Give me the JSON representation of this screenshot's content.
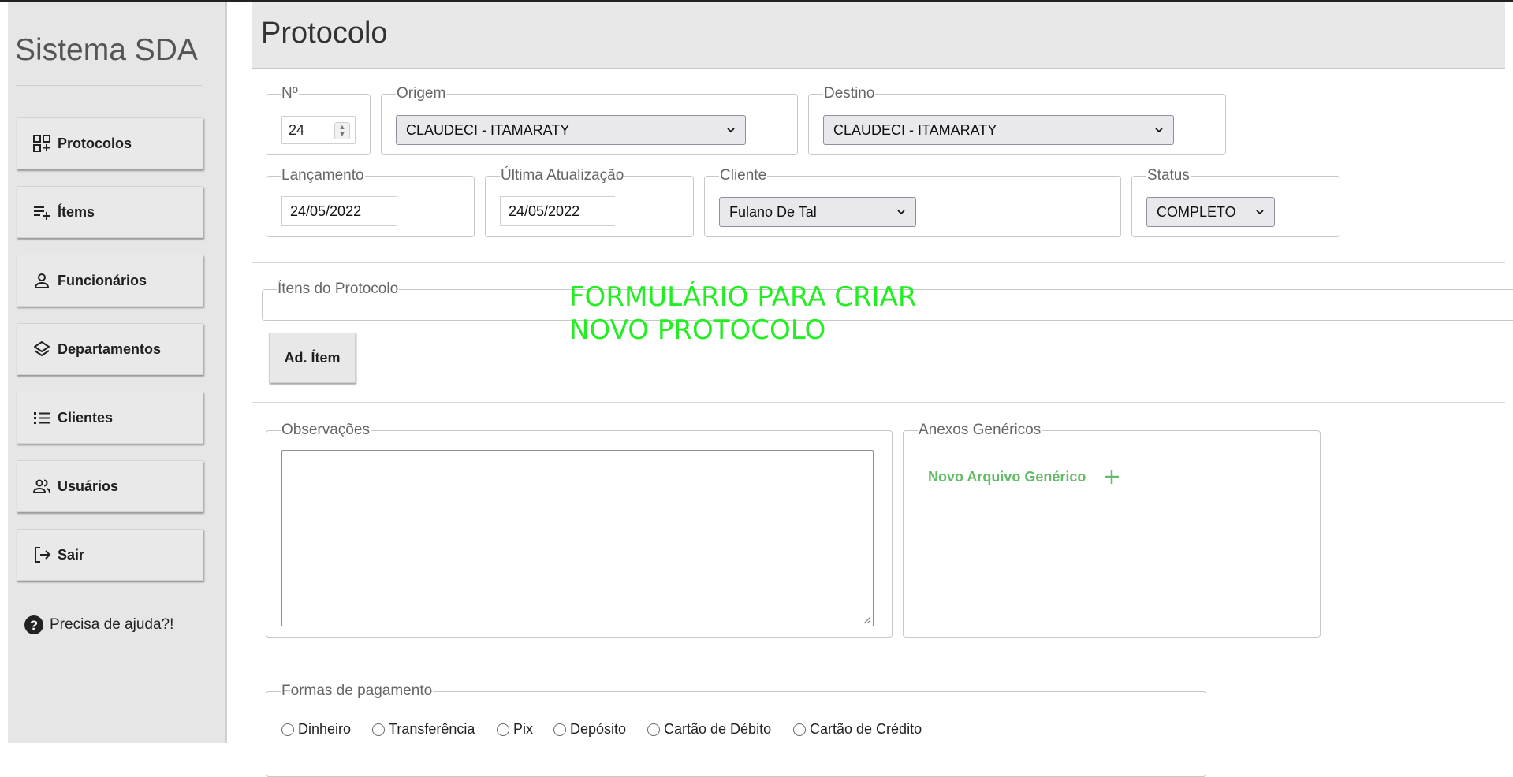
{
  "app": {
    "title": "Sistema SDA"
  },
  "sidebar": {
    "items": [
      {
        "label": "Protocolos",
        "icon": "add-grid-icon"
      },
      {
        "label": "Ítems",
        "icon": "playlist-add-icon"
      },
      {
        "label": "Funcionários",
        "icon": "person-icon"
      },
      {
        "label": "Departamentos",
        "icon": "layers-icon"
      },
      {
        "label": "Clientes",
        "icon": "list-icon"
      },
      {
        "label": "Usuários",
        "icon": "group-icon"
      },
      {
        "label": "Sair",
        "icon": "logout-icon"
      }
    ],
    "help": {
      "label": "Precisa de ajuda?!",
      "icon": "help-circle-icon"
    }
  },
  "header": {
    "title": "Protocolo"
  },
  "form": {
    "numero": {
      "legend": "Nº",
      "value": "24"
    },
    "origem": {
      "legend": "Origem",
      "value": "CLAUDECI - ITAMARATY"
    },
    "destino": {
      "legend": "Destino",
      "value": "CLAUDECI - ITAMARATY"
    },
    "lancamento": {
      "legend": "Lançamento",
      "value": "24/05/2022"
    },
    "ultima_atualizacao": {
      "legend": "Última Atualização",
      "value": "24/05/2022"
    },
    "cliente": {
      "legend": "Cliente",
      "value": "Fulano De Tal"
    },
    "status": {
      "legend": "Status",
      "value": "COMPLETO"
    },
    "itens": {
      "legend": "Ítens do Protocolo",
      "add_button": "Ad. Ítem"
    },
    "banner": {
      "line1": "FORMULÁRIO PARA CRIAR",
      "line2": "NOVO PROTOCOLO"
    },
    "observacoes": {
      "legend": "Observações",
      "value": ""
    },
    "anexos": {
      "legend": "Anexos Genéricos",
      "new_file_label": "Novo Arquivo Genérico"
    },
    "pagamento": {
      "legend": "Formas de pagamento",
      "options": [
        "Dinheiro",
        "Transferência",
        "Pix",
        "Depósito",
        "Cartão de Débito",
        "Cartão de Crédito"
      ]
    }
  },
  "colors": {
    "accent_green": "#66bb6a",
    "banner_green": "#22ee22",
    "sidebar_bg": "#e6e6e6"
  }
}
